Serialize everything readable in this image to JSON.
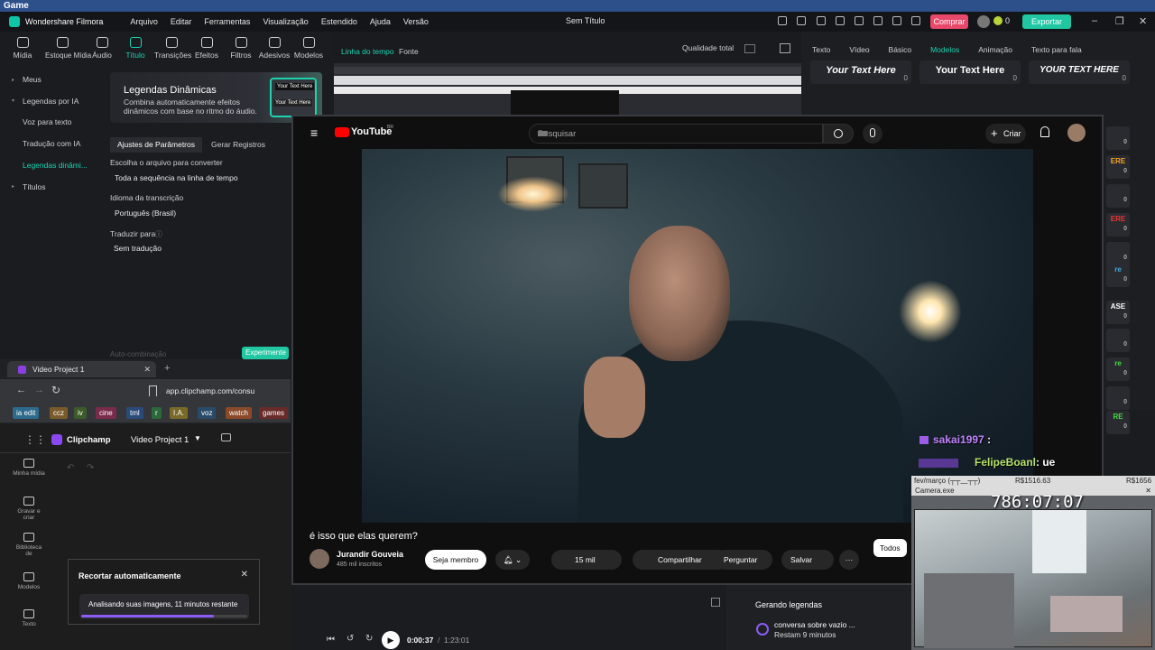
{
  "obs": {
    "title": "Game"
  },
  "menubar": {
    "app_name": "Wondershare Filmora",
    "menus": [
      "Arquivo",
      "Editar",
      "Ferramentas",
      "Visualização",
      "Estendido",
      "Ajuda",
      "Versão"
    ],
    "doc_title": "Sem Título",
    "buy_label": "Comprar",
    "credits": "0",
    "export_label": "Exportar"
  },
  "toolbar": {
    "items": [
      "Mídia",
      "Estoque Mídia",
      "Áudio",
      "Título",
      "Transições",
      "Efeitos",
      "Filtros",
      "Adesivos",
      "Modelos"
    ]
  },
  "preview": {
    "tab_timeline": "Linha do tempo",
    "tab_source": "Fonte",
    "quality": "Qualidade total"
  },
  "right_panel": {
    "tabs": [
      "Texto",
      "Vídeo",
      "Básico",
      "Modelos",
      "Animação",
      "Texto para fala"
    ],
    "active_tab": "Modelos",
    "cards": [
      {
        "text": "Your Text Here",
        "count": "0",
        "color": "#ffffff"
      },
      {
        "text": "Your Text Here",
        "count": "0",
        "color": "#ffffff"
      },
      {
        "text": "YOUR TEXT HERE",
        "count": "0",
        "color": "#ffffff"
      }
    ],
    "side_counts": [
      "0",
      "0",
      "0",
      "0",
      "0",
      "0",
      "0",
      "0",
      "0",
      "0",
      "0"
    ]
  },
  "left_nav": {
    "items": [
      "Meus",
      "Legendas por IA",
      "Voz para texto",
      "Tradução com IA",
      "Legendas dinâmi...",
      "Títulos"
    ],
    "active": "Legendas dinâmi..."
  },
  "captions": {
    "banner_title": "Legendas Dinâmicas",
    "banner_desc": "Combina automaticamente efeitos dinâmicos com base no ritmo do áudio.",
    "banner_badge_1": "Your Text Here",
    "banner_badge_2": "Your Text Here",
    "tab_params": "Ajustes de Parâmetros",
    "tab_generate": "Gerar Registros",
    "label_file": "Escolha o arquivo para converter",
    "value_file": "Toda a sequência na linha de tempo",
    "label_lang": "Idioma da transcrição",
    "value_lang": "Português (Brasil)",
    "label_translate": "Traduzir para",
    "value_translate": "Sem tradução",
    "auto_label": "Auto-combinação",
    "experiment": "Experimente"
  },
  "browser": {
    "tab_title": "Video Project 1",
    "url": "app.clipchamp.com/consu",
    "bookmarks": [
      {
        "label": "ia edit",
        "color": "#2d6a8c"
      },
      {
        "label": "ccz",
        "color": "#7a5a2a"
      },
      {
        "label": "iv",
        "color": "#3d5a2a"
      },
      {
        "label": "cine",
        "color": "#7a2a4a"
      },
      {
        "label": "tml",
        "color": "#2a4a7a"
      },
      {
        "label": "r",
        "color": "#2a6a3a"
      },
      {
        "label": "I.A.",
        "color": "#7a6a2a"
      },
      {
        "label": "voz",
        "color": "#2a4a6a"
      },
      {
        "label": "watch",
        "color": "#8a4a2a"
      },
      {
        "label": "games",
        "color": "#6a2a2a"
      }
    ]
  },
  "clipchamp": {
    "app_name": "Clipchamp",
    "project": "Video Project 1",
    "nav": [
      "Minha mídia",
      "Gravar e criar",
      "Biblioteca de",
      "Modelos",
      "Texto"
    ],
    "dialog_title": "Recortar automaticamente",
    "dialog_status": "Analisando suas imagens, 11 minutos restante",
    "progress": 0.8
  },
  "youtube": {
    "logo": "YouTube",
    "country": "BR",
    "search_placeholder": "Pesquisar",
    "create_label": "Criar",
    "video_title": "é isso que elas querem?",
    "channel": "Jurandir Gouveia",
    "subscribers": "485 mil inscritos",
    "member_label": "Seja membro",
    "likes": "15 mil",
    "share_label": "Compartilhar",
    "ask_label": "Perguntar",
    "save_label": "Salvar",
    "chip_all": "Todos"
  },
  "chat": [
    {
      "user": "sakai1997",
      "message": "",
      "color": "#c084fc"
    },
    {
      "user": "FelipeBoanl",
      "message": ": ue",
      "color": "#b5e26a"
    }
  ],
  "webcam": {
    "stats_left": "fev/março (┬┬﹏┬┬)",
    "stats_mid": "R$1516.63",
    "stats_right": "R$1656",
    "title": "Camera.exe",
    "clock": "786:07:07"
  },
  "player": {
    "time_current": "0:00:37",
    "time_total": "1:23:01"
  },
  "caption_gen": {
    "title": "Gerando legendas",
    "item": "conversa sobre vazio ...",
    "remaining": "Restam 9 minutos"
  }
}
